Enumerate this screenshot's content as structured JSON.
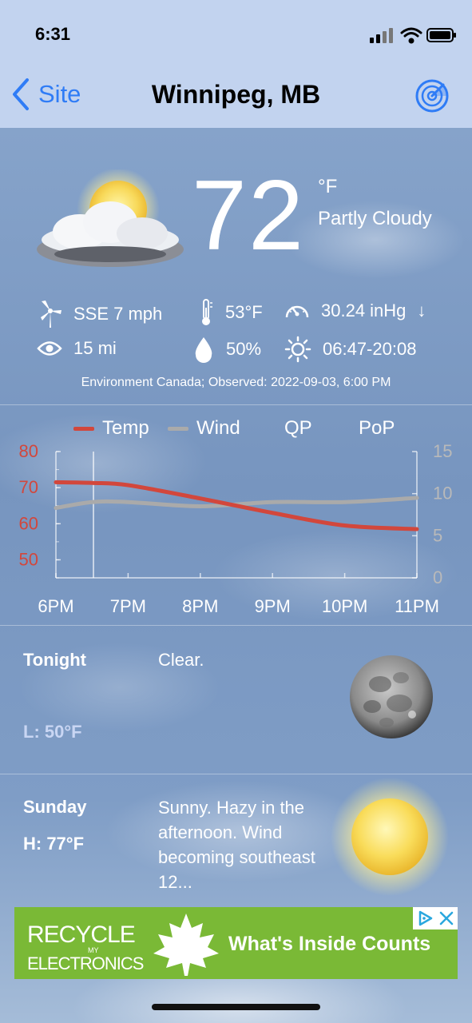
{
  "status_bar": {
    "time": "6:31"
  },
  "nav": {
    "back_label": "Site",
    "title": "Winnipeg, MB"
  },
  "current": {
    "temperature": "72",
    "unit": "°F",
    "condition": "Partly Cloudy",
    "wind": "SSE 7 mph",
    "feels_like": "53°F",
    "pressure": "30.24 inHg",
    "pressure_trend": "↓",
    "visibility": "15 mi",
    "humidity": "50%",
    "sun": "06:47-20:08",
    "source": "Environment Canada; Observed: 2022-09-03, 6:00 PM"
  },
  "legend": {
    "temp": "Temp",
    "wind": "Wind",
    "qp": "QP",
    "pop": "PoP"
  },
  "colors": {
    "temp": "#d2473c",
    "wind": "#aaaaaa",
    "link": "#2f7cf6",
    "ad": "#7ab936"
  },
  "chart_data": {
    "type": "line",
    "categories": [
      "6PM",
      "7PM",
      "8PM",
      "9PM",
      "10PM",
      "11PM"
    ],
    "y_left_ticks": [
      "80",
      "70",
      "60",
      "50"
    ],
    "y_right_ticks": [
      "15",
      "10",
      "5",
      "0"
    ],
    "ylim_left": [
      45,
      80
    ],
    "ylim_right": [
      0,
      15
    ],
    "series": [
      {
        "name": "Temp",
        "axis": "left",
        "x": [
          0,
          0.5,
          1,
          2,
          3,
          4,
          5
        ],
        "values": [
          71.5,
          71.3,
          70.7,
          67,
          63,
          59.5,
          58.5
        ]
      },
      {
        "name": "Wind",
        "axis": "right",
        "x": [
          0,
          0.5,
          1,
          2,
          3,
          4,
          5
        ],
        "values": [
          8.3,
          9.0,
          9.0,
          8.5,
          9.0,
          9.0,
          9.5
        ]
      }
    ]
  },
  "forecast": [
    {
      "period": "Tonight",
      "text": "Clear.",
      "temp": "L: 50°F",
      "icon": "moon-icon"
    },
    {
      "period": "Sunday",
      "text": "Sunny. Hazy in the afternoon. Wind becoming southeast 12...",
      "temp": "H: 77°F",
      "icon": "sun-icon"
    }
  ],
  "ad": {
    "line1": "RECYCLE",
    "line1_small": "MY",
    "line2": "ELECTRONICS",
    "tagline": "What's Inside Counts"
  }
}
